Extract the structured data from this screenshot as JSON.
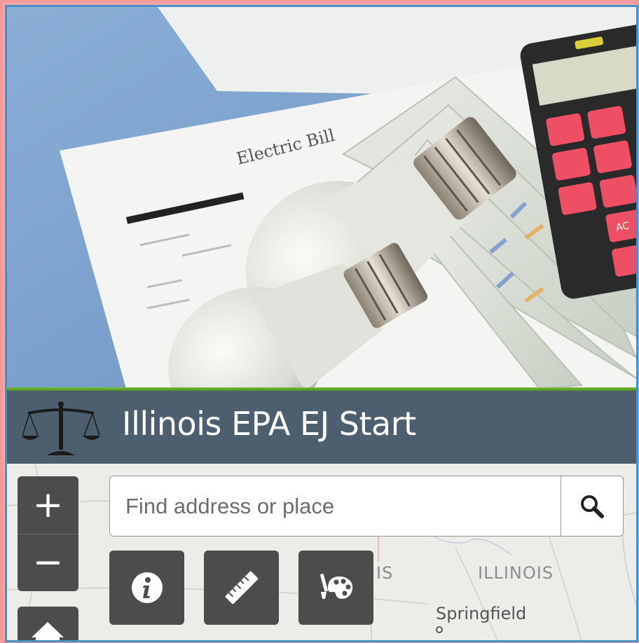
{
  "header": {
    "title": "Illinois EPA EJ Start",
    "logo_icon": "scales-of-justice-icon"
  },
  "photo": {
    "document_text": "Electric Bill",
    "calculator_key": "AC"
  },
  "search": {
    "placeholder": "Find address or place",
    "button_icon": "search-icon"
  },
  "zoom": {
    "in_label": "+",
    "out_label": "−"
  },
  "tools": [
    {
      "icon": "info-icon"
    },
    {
      "icon": "ruler-icon"
    },
    {
      "icon": "palette-icon"
    }
  ],
  "map": {
    "state_label": "ILLINOIS",
    "partial_label": "IS",
    "city_label": "Springfield"
  },
  "colors": {
    "header_bg": "#4d5f6f",
    "button_bg": "#4c4c4c",
    "accent_green": "#6bb536",
    "border_pink": "#f49a9a",
    "border_blue": "#4a90c4"
  }
}
